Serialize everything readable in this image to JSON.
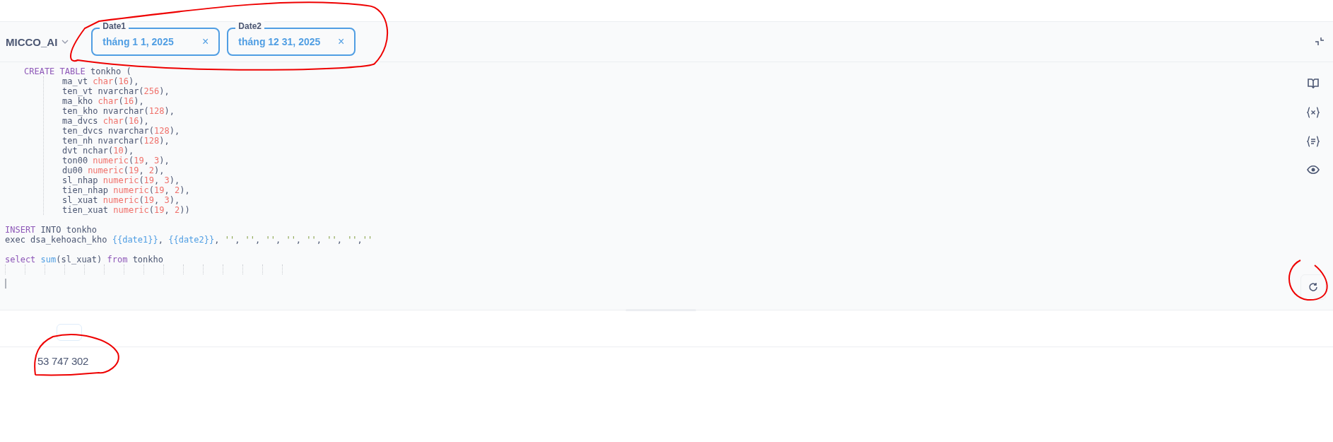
{
  "database": {
    "label": "MICCO_AI"
  },
  "date_filters": [
    {
      "label": "Date1",
      "value": "tháng 1 1, 2025",
      "clear": "×"
    },
    {
      "label": "Date2",
      "value": "tháng 12 31, 2025",
      "clear": "×"
    }
  ],
  "code_lines": [
    {
      "kind": "block",
      "children": [
        {
          "kind": "code",
          "tokens": [
            {
              "kind": "keyword",
              "text": "CREATE TABLE"
            },
            {
              "kind": "plain",
              "text": " tonkho ("
            }
          ],
          "children": [
            {
              "kind": "code",
              "tokens": [
                {
                  "kind": "plain",
                  "text": "ma_vt "
                },
                {
                  "kind": "type",
                  "text": "char"
                },
                {
                  "kind": "plain",
                  "text": "("
                },
                {
                  "kind": "number",
                  "text": "16"
                },
                {
                  "kind": "plain",
                  "text": "),"
                }
              ]
            },
            {
              "kind": "code",
              "tokens": [
                {
                  "kind": "plain",
                  "text": "ten_vt nvarchar("
                },
                {
                  "kind": "number",
                  "text": "256"
                },
                {
                  "kind": "plain",
                  "text": "),"
                }
              ]
            },
            {
              "kind": "code",
              "tokens": [
                {
                  "kind": "plain",
                  "text": "ma_kho "
                },
                {
                  "kind": "type",
                  "text": "char"
                },
                {
                  "kind": "plain",
                  "text": "("
                },
                {
                  "kind": "number",
                  "text": "16"
                },
                {
                  "kind": "plain",
                  "text": "),"
                }
              ]
            },
            {
              "kind": "code",
              "tokens": [
                {
                  "kind": "plain",
                  "text": "ten_kho nvarchar("
                },
                {
                  "kind": "number",
                  "text": "128"
                },
                {
                  "kind": "plain",
                  "text": "),"
                }
              ]
            },
            {
              "kind": "code",
              "tokens": [
                {
                  "kind": "plain",
                  "text": "ma_dvcs "
                },
                {
                  "kind": "type",
                  "text": "char"
                },
                {
                  "kind": "plain",
                  "text": "("
                },
                {
                  "kind": "number",
                  "text": "16"
                },
                {
                  "kind": "plain",
                  "text": "),"
                }
              ]
            },
            {
              "kind": "code",
              "tokens": [
                {
                  "kind": "plain",
                  "text": "ten_dvcs nvarchar("
                },
                {
                  "kind": "number",
                  "text": "128"
                },
                {
                  "kind": "plain",
                  "text": "),"
                }
              ]
            },
            {
              "kind": "code",
              "tokens": [
                {
                  "kind": "plain",
                  "text": "ten_nh nvarchar("
                },
                {
                  "kind": "number",
                  "text": "128"
                },
                {
                  "kind": "plain",
                  "text": "),"
                }
              ]
            },
            {
              "kind": "code",
              "tokens": [
                {
                  "kind": "plain",
                  "text": "dvt nchar("
                },
                {
                  "kind": "number",
                  "text": "10"
                },
                {
                  "kind": "plain",
                  "text": "),"
                }
              ]
            },
            {
              "kind": "code",
              "tokens": [
                {
                  "kind": "plain",
                  "text": "ton00 "
                },
                {
                  "kind": "type",
                  "text": "numeric"
                },
                {
                  "kind": "plain",
                  "text": "("
                },
                {
                  "kind": "number",
                  "text": "19"
                },
                {
                  "kind": "plain",
                  "text": ", "
                },
                {
                  "kind": "number",
                  "text": "3"
                },
                {
                  "kind": "plain",
                  "text": "),"
                }
              ]
            },
            {
              "kind": "code",
              "tokens": [
                {
                  "kind": "plain",
                  "text": "du00 "
                },
                {
                  "kind": "type",
                  "text": "numeric"
                },
                {
                  "kind": "plain",
                  "text": "("
                },
                {
                  "kind": "number",
                  "text": "19"
                },
                {
                  "kind": "plain",
                  "text": ", "
                },
                {
                  "kind": "number",
                  "text": "2"
                },
                {
                  "kind": "plain",
                  "text": "),"
                }
              ]
            },
            {
              "kind": "code",
              "tokens": [
                {
                  "kind": "plain",
                  "text": "sl_nhap "
                },
                {
                  "kind": "type",
                  "text": "numeric"
                },
                {
                  "kind": "plain",
                  "text": "("
                },
                {
                  "kind": "number",
                  "text": "19"
                },
                {
                  "kind": "plain",
                  "text": ", "
                },
                {
                  "kind": "number",
                  "text": "3"
                },
                {
                  "kind": "plain",
                  "text": "),"
                }
              ]
            },
            {
              "kind": "code",
              "tokens": [
                {
                  "kind": "plain",
                  "text": "tien_nhap "
                },
                {
                  "kind": "type",
                  "text": "numeric"
                },
                {
                  "kind": "plain",
                  "text": "("
                },
                {
                  "kind": "number",
                  "text": "19"
                },
                {
                  "kind": "plain",
                  "text": ", "
                },
                {
                  "kind": "number",
                  "text": "2"
                },
                {
                  "kind": "plain",
                  "text": "),"
                }
              ]
            },
            {
              "kind": "code",
              "tokens": [
                {
                  "kind": "plain",
                  "text": "sl_xuat "
                },
                {
                  "kind": "type",
                  "text": "numeric"
                },
                {
                  "kind": "plain",
                  "text": "("
                },
                {
                  "kind": "number",
                  "text": "19"
                },
                {
                  "kind": "plain",
                  "text": ", "
                },
                {
                  "kind": "number",
                  "text": "3"
                },
                {
                  "kind": "plain",
                  "text": "),"
                }
              ]
            },
            {
              "kind": "code",
              "tokens": [
                {
                  "kind": "plain",
                  "text": "tien_xuat "
                },
                {
                  "kind": "type",
                  "text": "numeric"
                },
                {
                  "kind": "plain",
                  "text": "("
                },
                {
                  "kind": "number",
                  "text": "19"
                },
                {
                  "kind": "plain",
                  "text": ", "
                },
                {
                  "kind": "number",
                  "text": "2"
                },
                {
                  "kind": "plain",
                  "text": "))"
                }
              ]
            }
          ]
        }
      ]
    },
    {
      "kind": "blank"
    },
    {
      "kind": "code",
      "tokens": [
        {
          "kind": "keyword",
          "text": "INSERT"
        },
        {
          "kind": "plain",
          "text": " INTO tonkho"
        }
      ]
    },
    {
      "kind": "code",
      "tokens": [
        {
          "kind": "plain",
          "text": "exec dsa_kehoach_kho "
        },
        {
          "kind": "variable",
          "text": "{{date1}}"
        },
        {
          "kind": "plain",
          "text": ", "
        },
        {
          "kind": "variable",
          "text": "{{date2}}"
        },
        {
          "kind": "plain",
          "text": ", "
        },
        {
          "kind": "string",
          "text": "''"
        },
        {
          "kind": "plain",
          "text": ", "
        },
        {
          "kind": "string",
          "text": "''"
        },
        {
          "kind": "plain",
          "text": ", "
        },
        {
          "kind": "string",
          "text": "''"
        },
        {
          "kind": "plain",
          "text": ", "
        },
        {
          "kind": "string",
          "text": "''"
        },
        {
          "kind": "plain",
          "text": ", "
        },
        {
          "kind": "string",
          "text": "''"
        },
        {
          "kind": "plain",
          "text": ", "
        },
        {
          "kind": "string",
          "text": "''"
        },
        {
          "kind": "plain",
          "text": ", "
        },
        {
          "kind": "string",
          "text": "''"
        },
        {
          "kind": "plain",
          "text": ","
        },
        {
          "kind": "string",
          "text": "''"
        }
      ]
    },
    {
      "kind": "blank"
    },
    {
      "kind": "code",
      "tokens": [
        {
          "kind": "keyword",
          "text": "select "
        },
        {
          "kind": "function",
          "text": "sum"
        },
        {
          "kind": "plain",
          "text": "(sl_xuat) "
        },
        {
          "kind": "keyword",
          "text": "from"
        },
        {
          "kind": "plain",
          "text": " tonkho"
        }
      ]
    }
  ],
  "result": {
    "value": "53 747 302"
  }
}
